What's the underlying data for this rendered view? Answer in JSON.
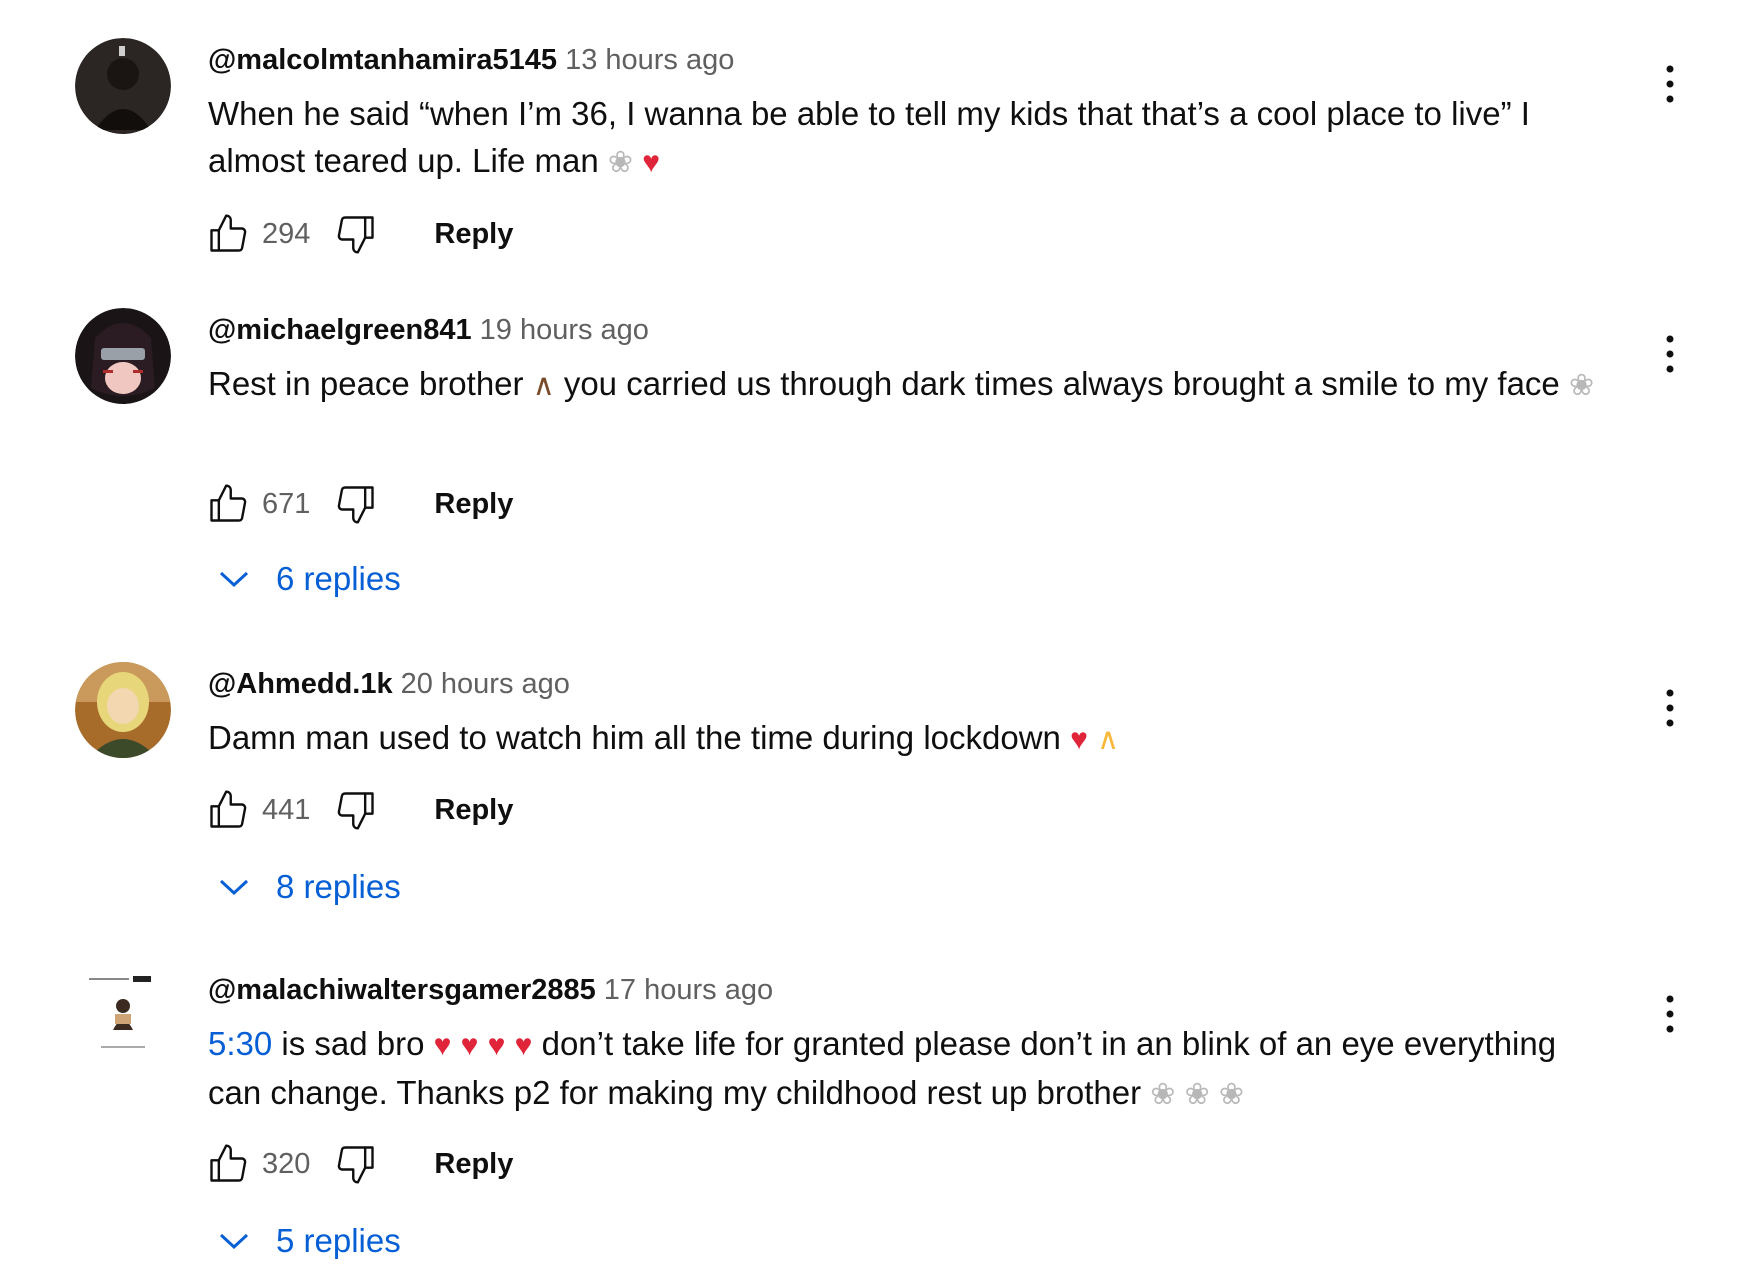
{
  "comments": [
    {
      "author": "@malcolmtanhamira5145",
      "time": "13 hours ago",
      "text_before": "",
      "timestamp_link": "",
      "text": "When he said  “when I’m 36, I wanna be able to tell my kids that that’s a cool place to live” I almost teared up. Life man ",
      "emojis": [
        "dove",
        "broken-heart"
      ],
      "likes": "294",
      "reply_label": "Reply",
      "replies_label": ""
    },
    {
      "author": "@michaelgreen841",
      "time": "19 hours ago",
      "text": "Rest in peace brother ",
      "text_after": " you carried us through dark times always brought a smile to my face ",
      "emojis": [
        "folded-hands-dark",
        "dove"
      ],
      "likes": "671",
      "reply_label": "Reply",
      "replies_label": "6 replies"
    },
    {
      "author": "@Ahmedd.1k",
      "time": "20 hours ago",
      "text": "Damn man used to watch him all the time during lockdown ",
      "emojis": [
        "broken-heart",
        "folded-hands"
      ],
      "likes": "441",
      "reply_label": "Reply",
      "replies_label": "8 replies"
    },
    {
      "author": "@malachiwaltersgamer2885",
      "time": "17 hours ago",
      "timestamp_link": "5:30",
      "text": " is sad bro ",
      "text_after": " don’t take life for granted please don’t in an blink of an eye everything can change. Thanks p2 for making my childhood rest up brother ",
      "emojis": [
        "broken-heart",
        "broken-heart",
        "broken-heart",
        "broken-heart",
        "dove",
        "dove",
        "dove"
      ],
      "likes": "320",
      "reply_label": "Reply",
      "replies_label": "5 replies"
    }
  ],
  "glyphs": {
    "broken_heart": "♥",
    "dove": "❀",
    "pray": "∧"
  },
  "colors": {
    "link": "#065fd4",
    "secondary_text": "#606060",
    "primary_text": "#0f0f0f"
  }
}
